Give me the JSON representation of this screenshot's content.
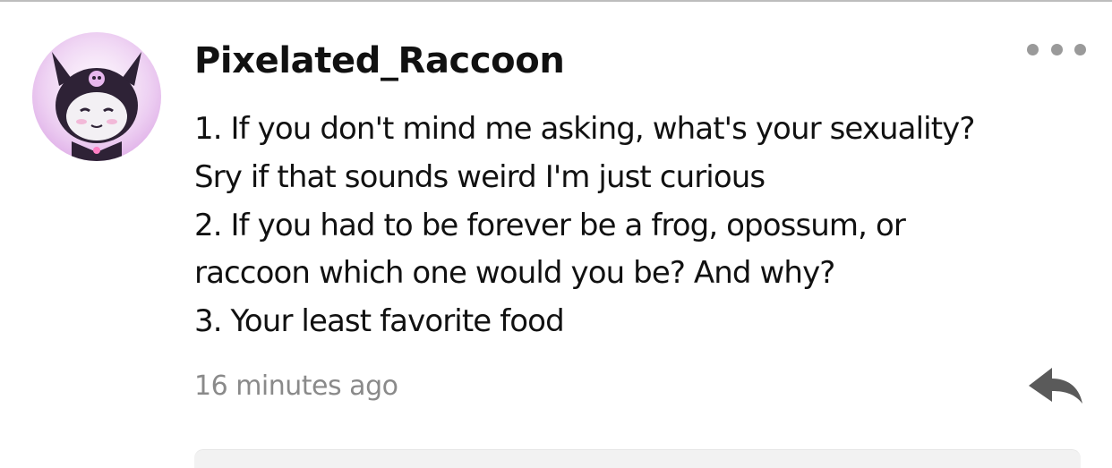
{
  "comment": {
    "username": "Pixelated_Raccoon",
    "message_lines": [
      "1. If you don't mind me asking, what's your sexuality?",
      "Sry if that sounds weird I'm just curious",
      "2. If you had to be forever be a frog, opossum, or",
      "raccoon which one would you be? And why?",
      "3. Your least favorite food"
    ],
    "timestamp": "16 minutes ago",
    "avatar_icon": "kuromi-avatar",
    "more_icon": "more-options-dots-icon",
    "reply_icon": "reply-arrow-icon"
  },
  "colors": {
    "text": "#111111",
    "muted": "#8a8a8a",
    "icon": "#9a9a9a",
    "reply_icon": "#5a5a5a",
    "avatar_bg": "#e9c4ef"
  }
}
